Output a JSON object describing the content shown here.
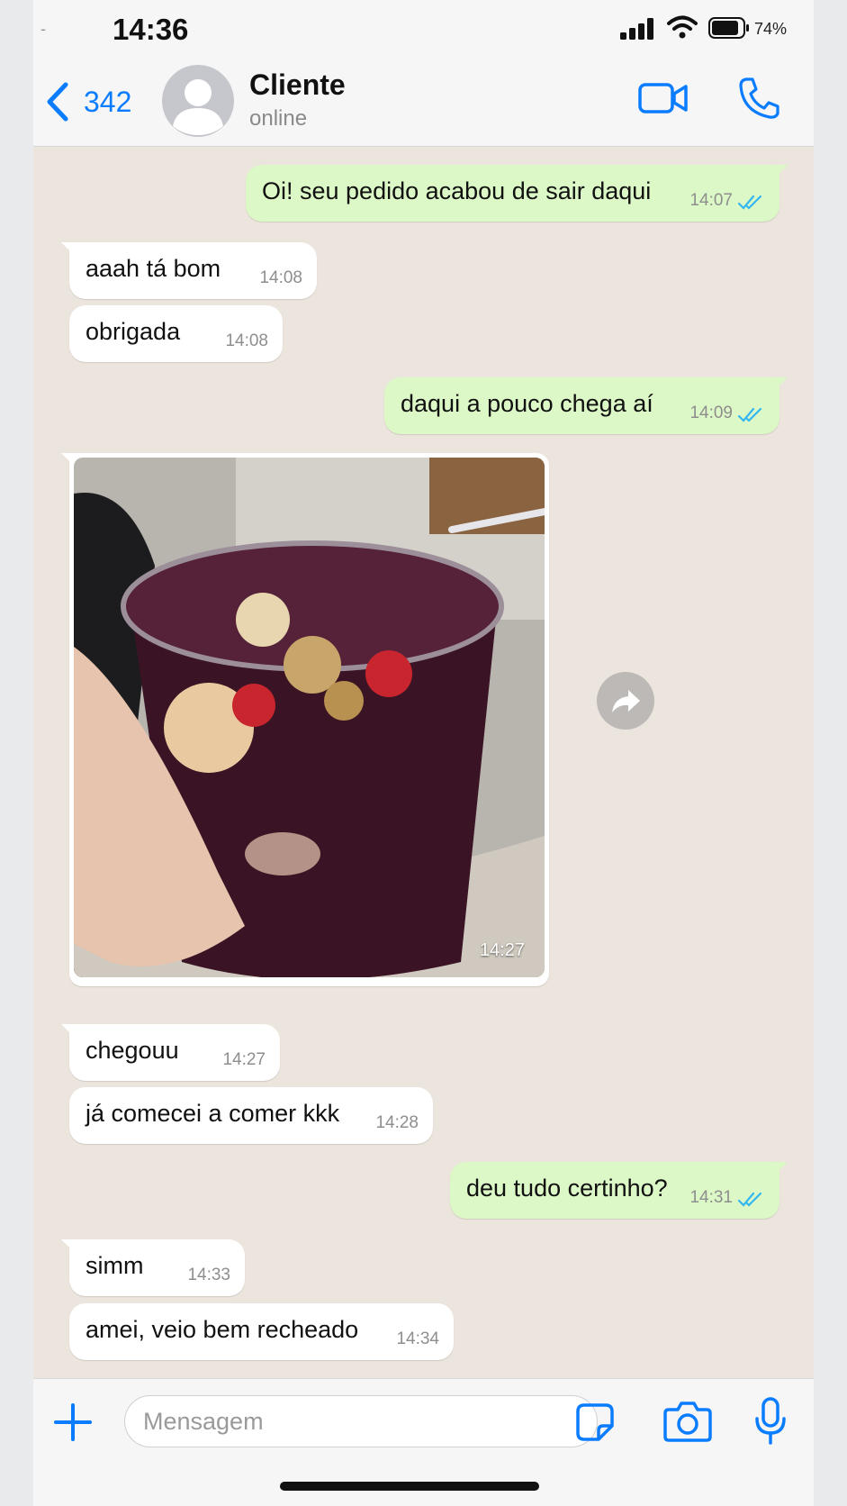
{
  "status_bar": {
    "dash": "-",
    "time": "14:36",
    "battery_percent": "74%",
    "icons": [
      "signal-icon",
      "wifi-icon",
      "battery-icon"
    ]
  },
  "header": {
    "back_count": "342",
    "contact_name": "Cliente",
    "contact_status": "online",
    "icons": [
      "chevron-left-icon",
      "avatar-placeholder-icon",
      "video-camera-icon",
      "phone-icon"
    ]
  },
  "messages": [
    {
      "direction": "out",
      "text": "Oi! seu pedido acabou de sair daqui",
      "time": "14:07",
      "read": true
    },
    {
      "direction": "in",
      "text": "aaah tá bom",
      "time": "14:08"
    },
    {
      "direction": "in",
      "text": "obrigada",
      "time": "14:08"
    },
    {
      "direction": "out",
      "text": "daqui a pouco chega aí",
      "time": "14:09",
      "read": true
    },
    {
      "direction": "in",
      "type": "image",
      "time": "14:27",
      "forward_icon": "forward-icon"
    },
    {
      "direction": "in",
      "text": "chegouu",
      "time": "14:27"
    },
    {
      "direction": "in",
      "text": "já comecei a comer kkk",
      "time": "14:28"
    },
    {
      "direction": "out",
      "text": "deu tudo certinho?",
      "time": "14:31",
      "read": true
    },
    {
      "direction": "in",
      "text": "simm",
      "time": "14:33"
    },
    {
      "direction": "in",
      "text": "amei, veio bem recheado",
      "time": "14:34"
    }
  ],
  "input_bar": {
    "placeholder": "Mensagem",
    "icons": [
      "plus-icon",
      "sticker-icon",
      "camera-icon",
      "microphone-icon"
    ]
  },
  "colors": {
    "accent": "#0a7cff",
    "outgoing_bubble": "#dcf8c6",
    "incoming_bubble": "#ffffff",
    "chat_background": "#ece5dd",
    "read_ticks": "#34b7f1"
  }
}
